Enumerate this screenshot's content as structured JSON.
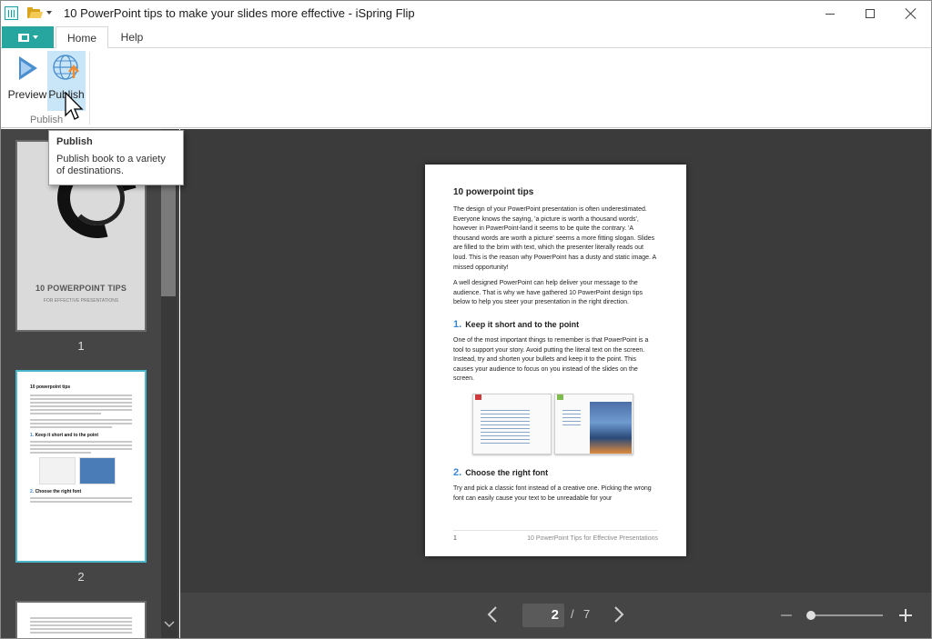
{
  "window": {
    "title": "10 PowerPoint tips to make your slides more effective - iSpring Flip"
  },
  "ribbon": {
    "tabs": [
      {
        "label": "Home",
        "active": true
      },
      {
        "label": "Help",
        "active": false
      }
    ],
    "buttons": {
      "preview": "Preview",
      "publish": "Publish"
    },
    "group_label": "Publish"
  },
  "tooltip": {
    "title": "Publish",
    "body": "Publish book to a variety of destinations."
  },
  "thumbnails": [
    {
      "number": "1",
      "cover_title": "10 POWERPOINT TIPS",
      "cover_subtitle": "FOR EFFECTIVE PRESENTATIONS"
    },
    {
      "number": "2",
      "active": true,
      "mini_title": "10 powerpoint tips",
      "mini_h1": "Keep it short and to the point",
      "mini_h2": "Choose the right font"
    }
  ],
  "page": {
    "title": "10 powerpoint tips",
    "para1": "The design of your PowerPoint presentation is often underestimated. Everyone knows the saying, 'a picture is worth a thousand words', however in PowerPoint-land it seems to be quite the contrary. 'A thousand words are worth a picture' seems a more fitting slogan. Slides are filled to the brim with text, which the presenter literally reads out loud. This is the reason why PowerPoint has a dusty and static image. A missed opportunity!",
    "para2": "A well designed PowerPoint can help deliver your message to the audience. That is why we have gathered 10 PowerPoint design tips below to help you steer your presentation in the right direction.",
    "section1_num": "1.",
    "section1_title": "Keep it short and to the point",
    "section1_text": "One of the most important things to remember is that PowerPoint is a tool to support your story. Avoid putting the literal text on the screen. Instead, try and shorten your bullets and keep it to the point. This causes your audience to focus on you instead of the slides on the screen.",
    "section2_num": "2.",
    "section2_title": "Choose the right font",
    "section2_text": "Try and pick a classic font instead of a creative one. Picking the wrong font can easily cause your text to be unreadable for your",
    "footer_page": "1",
    "footer_text": "10 PowerPoint Tips for Effective Presentations"
  },
  "navigation": {
    "current_page": "2",
    "separator": "/",
    "total_pages": "7"
  },
  "colors": {
    "accent": "#26a69f",
    "publish_highlight": "#c9e6f8",
    "heading_number": "#3a86d1",
    "viewer_bg": "#3b3b3b"
  }
}
